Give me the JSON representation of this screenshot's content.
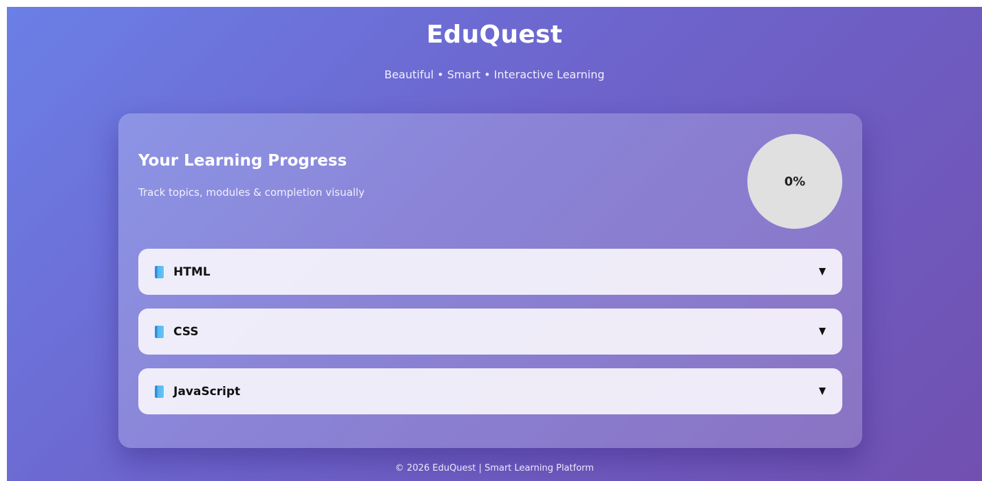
{
  "header": {
    "title": "EduQuest",
    "subtitle": "Beautiful • Smart • Interactive Learning"
  },
  "progress_card": {
    "title": "Your Learning Progress",
    "subtitle": "Track topics, modules & completion visually",
    "percent_label": "0%",
    "percent_value": 0
  },
  "modules": [
    {
      "label": "HTML",
      "icon": "book-icon"
    },
    {
      "label": "CSS",
      "icon": "book-icon"
    },
    {
      "label": "JavaScript",
      "icon": "book-icon"
    }
  ],
  "footer": {
    "text": "© 2026 EduQuest | Smart Learning Platform"
  },
  "colors": {
    "gradient_start": "#6b7fe6",
    "gradient_end": "#7150b0",
    "progress_circle": "#e0e0e0"
  }
}
